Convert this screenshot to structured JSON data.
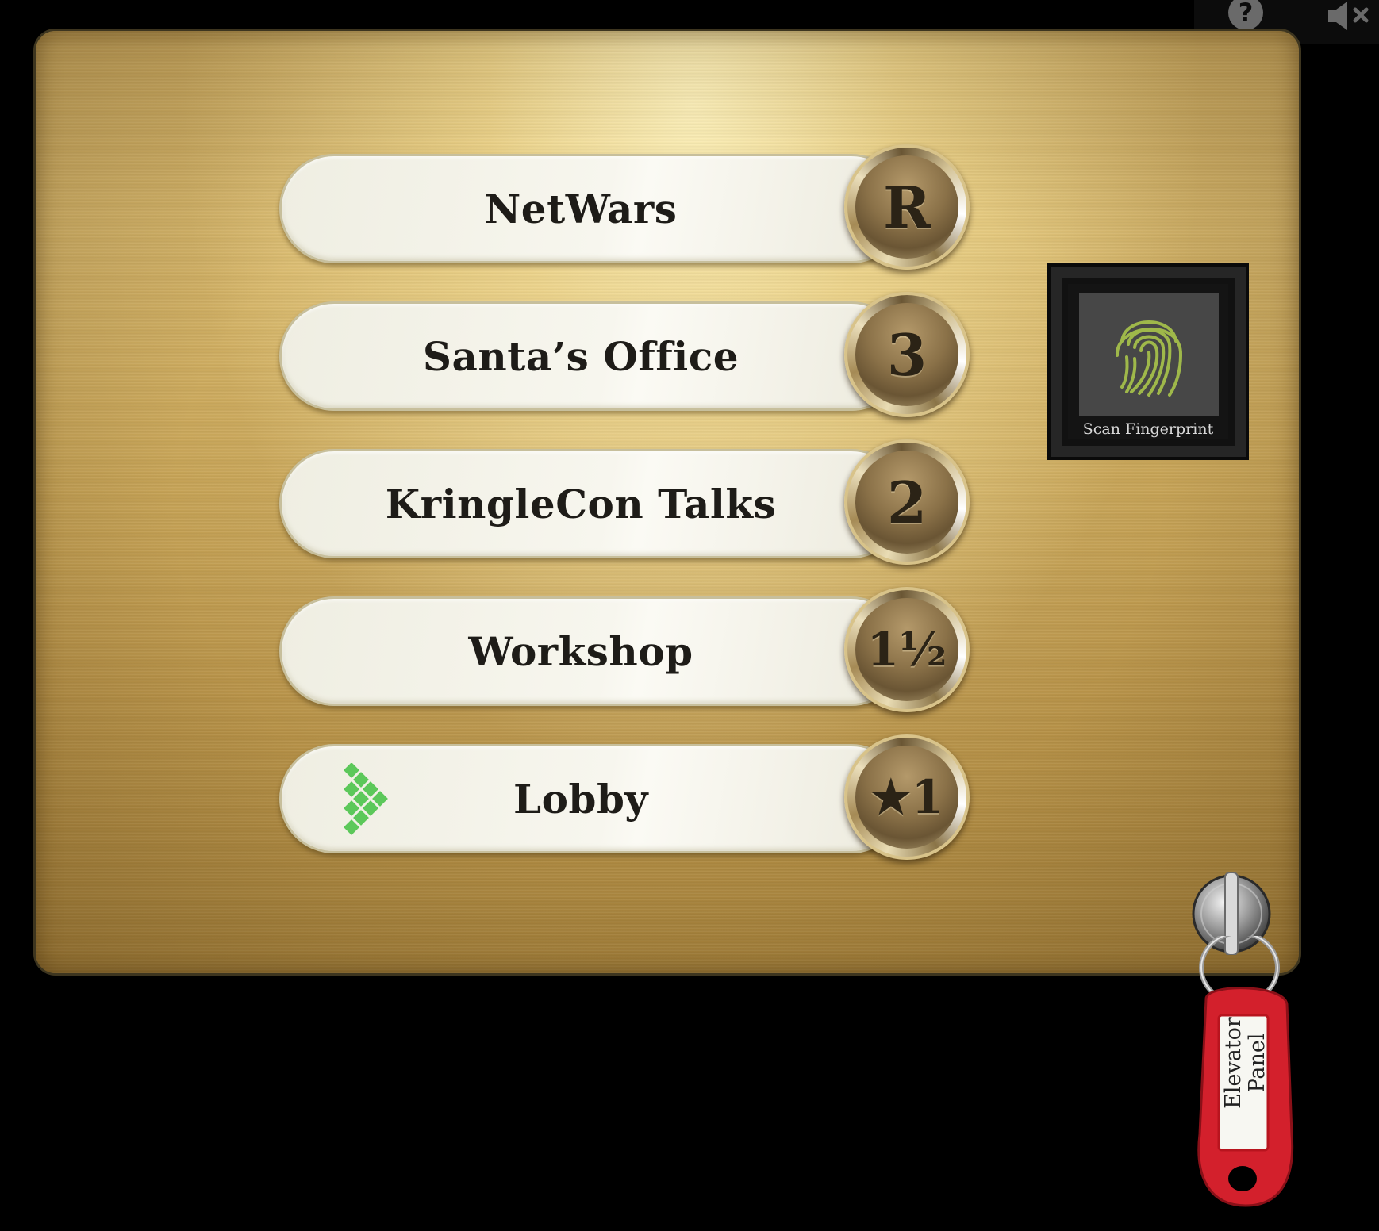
{
  "header": {
    "help_icon": "?",
    "mute_icon_name": "speaker-muted-icon"
  },
  "floors": [
    {
      "label": "NetWars",
      "button": "R"
    },
    {
      "label": "Santa’s Office",
      "button": "3"
    },
    {
      "label": "KringleCon Talks",
      "button": "2"
    },
    {
      "label": "Workshop",
      "button": "1½"
    },
    {
      "label": "Lobby",
      "button": "★1"
    }
  ],
  "scanner": {
    "caption": "Scan Fingerprint"
  },
  "keytag": {
    "line1": "Elevator",
    "line2": "Panel"
  },
  "colors": {
    "brass": "#c9a659",
    "pill": "#f4f3ea",
    "logo_green": "#5cc85a",
    "fingerprint_green": "#9fb84a",
    "tag_red": "#d3202c"
  }
}
